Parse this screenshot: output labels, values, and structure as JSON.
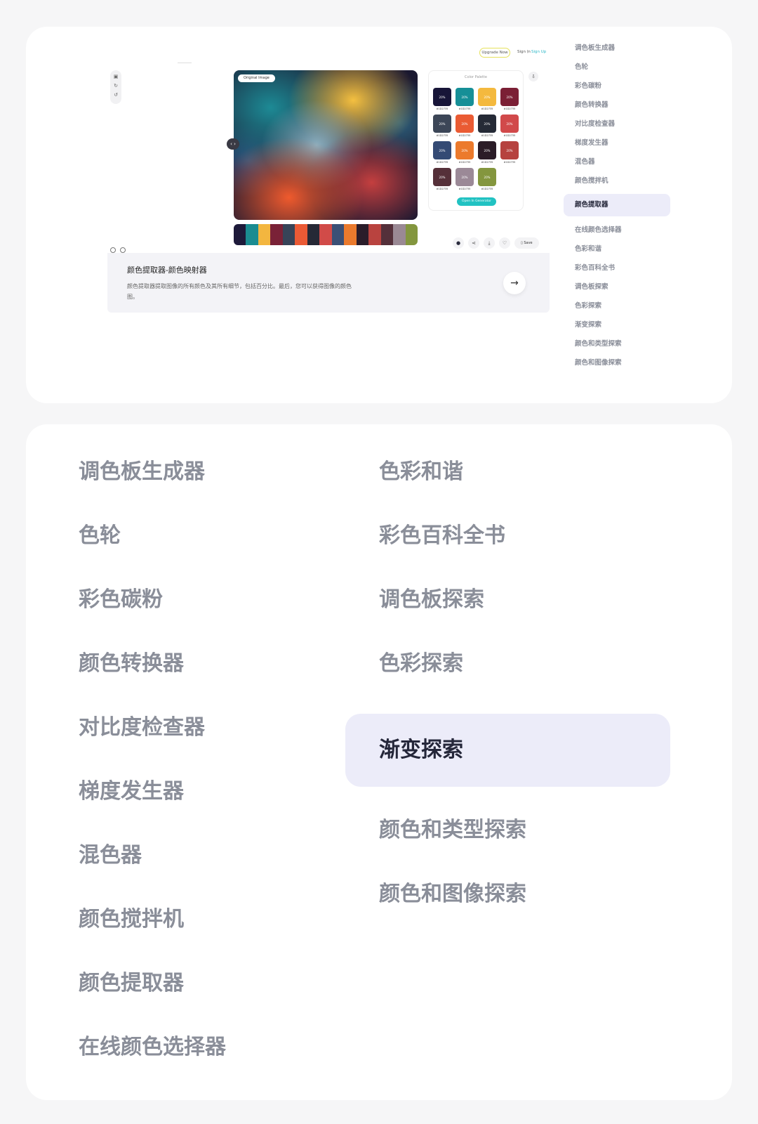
{
  "preview": {
    "header": {
      "upgrade": "Upgrade Now",
      "signin": "Sign In",
      "divider": "|",
      "signup": "Sign Up"
    },
    "toolbar_icons": [
      "camera-icon",
      "redo-icon",
      "undo-icon"
    ],
    "image_tag": "Original Image",
    "compare_handle": "‹ ›",
    "strip_colors": [
      "#1e1a3a",
      "#1a8c91",
      "#f3b63f",
      "#7a2237",
      "#374458",
      "#ea5a35",
      "#262936",
      "#d14b48",
      "#3b5076",
      "#ea7a2d",
      "#2a1d2a",
      "#b9433f",
      "#54303a",
      "#9a8994",
      "#83963e"
    ],
    "palette": {
      "title": "Color Palette",
      "swatches": [
        {
          "color": "#171538",
          "pct": "20%",
          "hex": "#1D2735"
        },
        {
          "color": "#168f97",
          "pct": "20%",
          "hex": "#1D2735"
        },
        {
          "color": "#f4b93e",
          "pct": "20%",
          "hex": "#1D2735"
        },
        {
          "color": "#7b1f35",
          "pct": "20%",
          "hex": "#1D2735"
        },
        {
          "color": "#3c4657",
          "pct": "20%",
          "hex": "#1D2735"
        },
        {
          "color": "#ea5b33",
          "pct": "20%",
          "hex": "#1D2735"
        },
        {
          "color": "#252a36",
          "pct": "20%",
          "hex": "#1D2735"
        },
        {
          "color": "#d1494a",
          "pct": "20%",
          "hex": "#1D2735"
        },
        {
          "color": "#344a74",
          "pct": "20%",
          "hex": "#1D2735"
        },
        {
          "color": "#ec7a2c",
          "pct": "20%",
          "hex": "#1D2735"
        },
        {
          "color": "#2b1c27",
          "pct": "20%",
          "hex": "#1D2735"
        },
        {
          "color": "#b6423f",
          "pct": "20%",
          "hex": "#1D2735"
        },
        {
          "color": "#553039",
          "pct": "20%",
          "hex": "#1D2735"
        },
        {
          "color": "#9b8997",
          "pct": "20%",
          "hex": "#1D2735"
        },
        {
          "color": "#84963e",
          "pct": "20%",
          "hex": "#1D2735"
        }
      ],
      "open_generator": "Open In Generator"
    },
    "actions": {
      "save": "Save"
    },
    "info": {
      "title": "颜色提取器-颜色映射器",
      "desc": "颜色提取器提取图像的所有颜色及其所有细节，包括百分比。最后，您可以获得图像的颜色图。",
      "arrow": "→"
    }
  },
  "sidebar": {
    "items": [
      {
        "label": "调色板生成器"
      },
      {
        "label": "色轮"
      },
      {
        "label": "彩色碳粉"
      },
      {
        "label": "颜色转换器"
      },
      {
        "label": "对比度检查器"
      },
      {
        "label": "梯度发生器"
      },
      {
        "label": "混色器"
      },
      {
        "label": "颜色搅拌机"
      },
      {
        "label": "颜色提取器"
      },
      {
        "label": "在线颜色选择器"
      },
      {
        "label": "色彩和谐"
      },
      {
        "label": "彩色百科全书"
      },
      {
        "label": "调色板探索"
      },
      {
        "label": "色彩探索"
      },
      {
        "label": "渐变探索"
      },
      {
        "label": "颜色和类型探索"
      },
      {
        "label": "颜色和图像探索"
      }
    ],
    "active_index": 8
  },
  "big_menu": {
    "left": [
      {
        "label": "调色板生成器"
      },
      {
        "label": "色轮"
      },
      {
        "label": "彩色碳粉"
      },
      {
        "label": "颜色转换器"
      },
      {
        "label": "对比度检查器"
      },
      {
        "label": "梯度发生器"
      },
      {
        "label": "混色器"
      },
      {
        "label": "颜色搅拌机"
      },
      {
        "label": "颜色提取器"
      },
      {
        "label": "在线颜色选择器"
      }
    ],
    "right": [
      {
        "label": "色彩和谐"
      },
      {
        "label": "彩色百科全书"
      },
      {
        "label": "调色板探索"
      },
      {
        "label": "色彩探索"
      },
      {
        "label": "渐变探索"
      },
      {
        "label": "颜色和类型探索"
      },
      {
        "label": "颜色和图像探索"
      }
    ],
    "active": "渐变探索"
  }
}
